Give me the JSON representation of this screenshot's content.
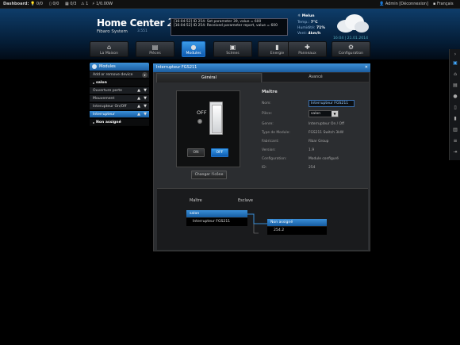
{
  "topbar": {
    "dashboard_label": "Dashboard:",
    "lights": "0/0",
    "doors": "0/0",
    "windows": "0/3",
    "alarms": "1",
    "power": "1/0.00W",
    "user": "Admin [Déconnexion]",
    "language": "Français"
  },
  "header": {
    "brand": "Home Center",
    "brand_num": "2",
    "subtitle": "Fibaro System",
    "version": "3.551",
    "log_lines": [
      "[16:04:52] ID 254: Set parameter 39, value = 600",
      "[16:04:52] ID 254: Received parameter report, value = 600"
    ],
    "weather": {
      "city": "Melun",
      "temp_label": "Temp.:",
      "temp_value": "7°C",
      "humidity_label": "Humidité:",
      "humidity_value": "71%",
      "wind_label": "Vent:",
      "wind_value": "4km/h"
    },
    "datetime": "16:04 | 21.01.2014"
  },
  "menu": [
    {
      "label": "La Maison",
      "icon": "house-icon"
    },
    {
      "label": "Pièces",
      "icon": "rooms-icon"
    },
    {
      "label": "Modules",
      "icon": "bulb-icon"
    },
    {
      "label": "Scènes",
      "icon": "scenes-icon"
    },
    {
      "label": "Energie",
      "icon": "energy-icon"
    },
    {
      "label": "Panneaux",
      "icon": "panels-icon"
    },
    {
      "label": "Configuration",
      "icon": "gears-icon"
    }
  ],
  "sidebar": {
    "title": "Modules",
    "add_remove": "Add or remove device",
    "room": "salon",
    "items": [
      "Ouverture porte",
      "Mouvement",
      "Interupteur On/Off",
      "Interrupteur"
    ],
    "sub_item": "Non assigné"
  },
  "panel": {
    "title": "Interrupteur FGS211",
    "tab_general": "Général",
    "tab_advanced": "Avancé",
    "switch_state": "OFF",
    "btn_on": "ON",
    "btn_off": "OFF",
    "change_icon": "Changer l'icône",
    "section": "Maître",
    "fields": {
      "name_label": "Nom:",
      "name_value": "Interrupteur FGS211",
      "room_label": "Pièce:",
      "room_value": "salon",
      "genre_label": "Genre:",
      "genre_value": "Interrupteur On / Off",
      "type_label": "Type de Module:",
      "type_value": "FGS211 Switch 3kW",
      "maker_label": "Fabricant:",
      "maker_value": "Fibar Group",
      "version_label": "Version:",
      "version_value": "1.9",
      "config_label": "Configuration:",
      "config_value": "Module configuré",
      "id_label": "ID:",
      "id_value": "254"
    },
    "assoc": {
      "master_label": "Maître",
      "slave_label": "Esclave",
      "master_room": "salon",
      "master_device": "Interrupteur FGS211",
      "slave_room": "Non assigné",
      "slave_device": "254.2"
    }
  }
}
